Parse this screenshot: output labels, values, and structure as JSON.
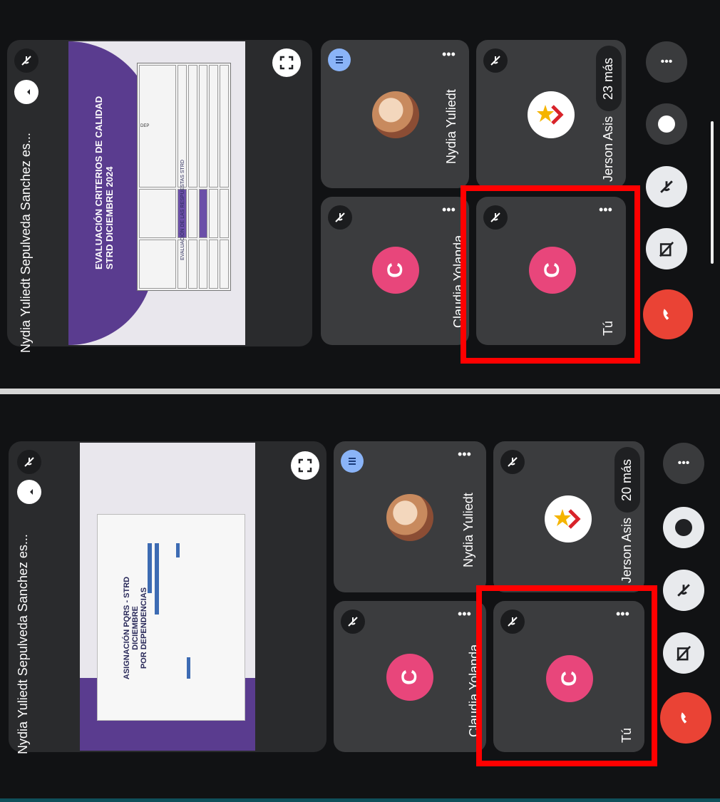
{
  "panels": [
    {
      "share": {
        "presenter_label": "Nydia Yuliedt Sepulveda Sanchez es...",
        "slide": {
          "title_line1": "EVALUACIÓN CRITERIOS DE CALIDAD",
          "title_line2": "STRD DICIEMBRE 2024",
          "table_caption": "EVALUACIÓN DE LAS RESPUESTAS STRD"
        }
      },
      "tiles": {
        "nydia": "Nydia Yuliedt",
        "jerson": "Jerson Asis",
        "claudia": "Claudia Yolanda",
        "self": "Tú",
        "avatar_letter": "C",
        "more_count": "23 más"
      }
    },
    {
      "share": {
        "presenter_label": "Nydia Yuliedt Sepulveda Sanchez es...",
        "slide": {
          "title_line1": "ASIGNACIÓN PQRS - STRD",
          "title_line2": "DICIEMBRE",
          "title_line3": "POR DEPENDENCIAS"
        }
      },
      "tiles": {
        "nydia": "Nydia Yuliedt",
        "jerson": "Jerson Asis",
        "claudia": "Claudia Yolanda",
        "self": "Tú",
        "avatar_letter": "C",
        "more_count": "20 más"
      }
    }
  ],
  "controls": [
    "more-options-icon",
    "raise-hand-icon",
    "mic-off-icon",
    "camera-off-icon",
    "end-call-icon"
  ],
  "colors": {
    "background": "#111214",
    "tile": "#3b3c3e",
    "avatar": "#e8467b",
    "end_call": "#ea4335",
    "highlight": "#ff0000",
    "slide_purple": "#5a3c8f"
  }
}
